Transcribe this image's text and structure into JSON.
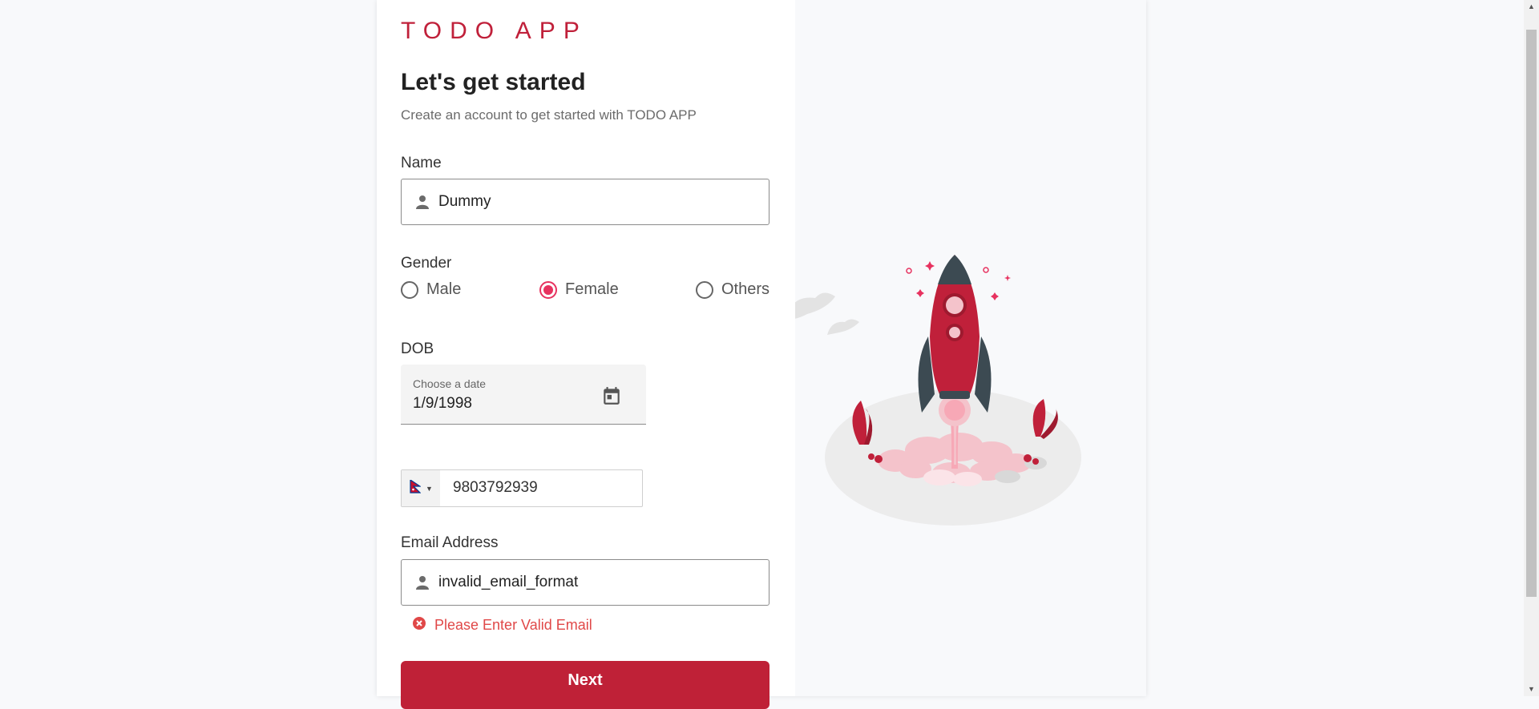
{
  "brand": "TODO APP",
  "title": "Let's get started",
  "subtitle": "Create an account to get started with TODO APP",
  "name": {
    "label": "Name",
    "value": "Dummy",
    "icon": "person-icon"
  },
  "gender": {
    "label": "Gender",
    "options": [
      "Male",
      "Female",
      "Others"
    ],
    "selected": "Female"
  },
  "dob": {
    "label": "DOB",
    "placeholder_label": "Choose a date",
    "value": "1/9/1998",
    "icon": "calendar-icon"
  },
  "phone": {
    "value": "9803792939",
    "country_flag": "nepal-flag-icon"
  },
  "email": {
    "label": "Email Address",
    "value": "invalid_email_format",
    "icon": "person-icon",
    "error": "Please Enter Valid Email"
  },
  "next_button": "Next",
  "colors": {
    "brand": "#c0203a",
    "radio_selected": "#e7325f",
    "error": "#e04848",
    "button": "#bf2137"
  }
}
